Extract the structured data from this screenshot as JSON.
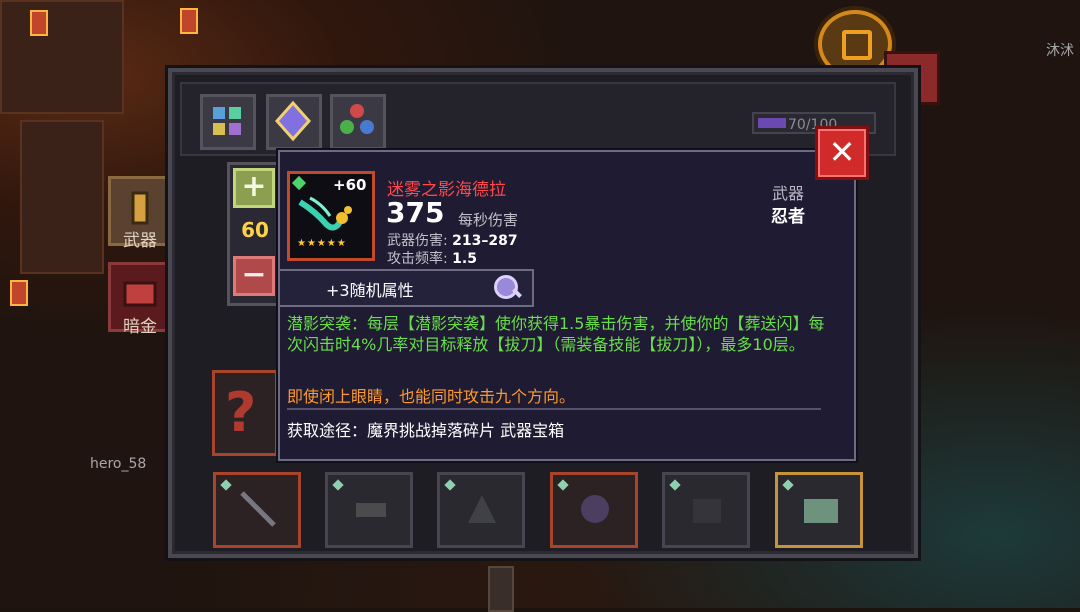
{
  "background": {
    "player_names": [
      "沐沭",
      "hero_58"
    ],
    "side_tabs": [
      {
        "label": "武器",
        "icon": "sword-icon"
      },
      {
        "label": "暗金",
        "icon": "chest-icon"
      }
    ],
    "health_text": "70/100"
  },
  "inventory": {
    "tabs": [
      "grid-icon",
      "crystal-icon",
      "orbs-icon"
    ],
    "close_label": "✕"
  },
  "weapon_card": {
    "level": "60",
    "plus_label": "+",
    "minus_label": "−",
    "enhance": "+60",
    "stars": "★★★★★",
    "name": "迷雾之影海德拉",
    "dps_value": "375",
    "dps_label": "每秒伤害",
    "damage_label": "武器伤害:",
    "damage_value": "213–287",
    "rate_label": "攻击频率:",
    "rate_value": "1.5",
    "type": "武器",
    "class": "忍者",
    "random_attrs": "+3随机属性",
    "skill_desc": "潜影突袭：每层【潜影突袭】使你获得1.5暴击伤害，并使你的【葬送闪】每次闪击时4%几率对目标释放【拔刀】（需装备技能【拔刀】），最多10层。",
    "flavor": "即使闭上眼睛，也能同时攻击九个方向。",
    "source": "获取途径：魔界挑战掉落碎片 武器宝箱",
    "close_label": "✕"
  },
  "colors": {
    "weapon_name": "#ff4a4a",
    "skill_text": "#6ade4a",
    "flavor_text": "#ff9a2a",
    "level_text": "#ffd24a",
    "close_button": "#d02a2a"
  }
}
